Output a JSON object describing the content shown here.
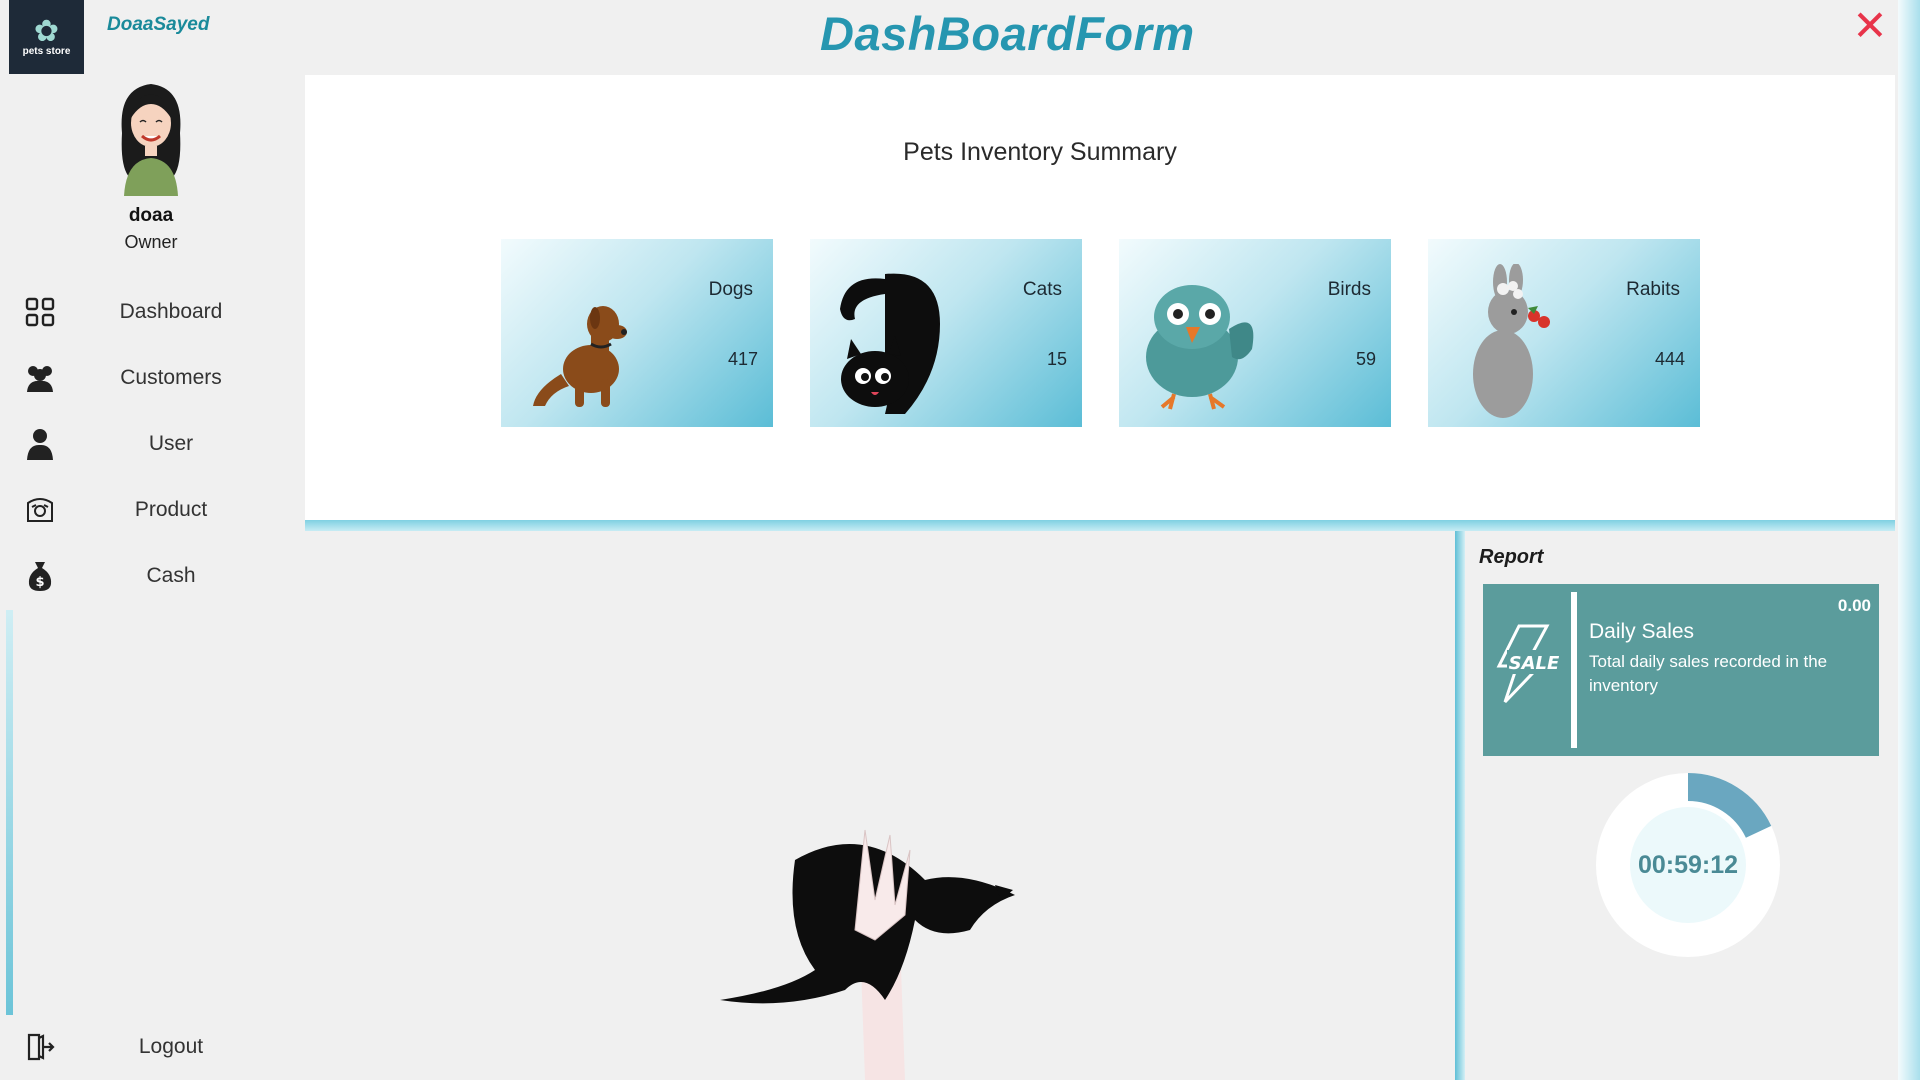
{
  "window": {
    "title": "DashBoardForm",
    "close_glyph": "✕"
  },
  "sidebar": {
    "brand": "DoaaSayed",
    "logo_text": "pets store",
    "user": {
      "name": "doaa",
      "role": "Owner"
    },
    "items": [
      {
        "label": "Dashboard",
        "icon": "dashboard-grid-icon"
      },
      {
        "label": "Customers",
        "icon": "customers-icon"
      },
      {
        "label": "User",
        "icon": "user-icon"
      },
      {
        "label": "Product",
        "icon": "product-icon"
      },
      {
        "label": "Cash",
        "icon": "money-bag-icon"
      }
    ],
    "logout_label": "Logout"
  },
  "summary": {
    "title": "Pets Inventory Summary",
    "cards": [
      {
        "label": "Dogs",
        "count": "417",
        "icon": "dog-icon"
      },
      {
        "label": "Cats",
        "count": "15",
        "icon": "cat-icon"
      },
      {
        "label": "Birds",
        "count": "59",
        "icon": "bird-icon"
      },
      {
        "label": "Rabits",
        "count": "444",
        "icon": "rabbit-icon"
      }
    ]
  },
  "report": {
    "title": "Report",
    "daily_sales": {
      "value": "0.00",
      "title": "Daily Sales",
      "description": "Total daily sales recorded in the inventory",
      "icon_text": "SALE"
    },
    "timer": {
      "text": "00:59:12",
      "progress": 0.18
    }
  },
  "colors": {
    "accent": "#2696b0",
    "close": "#e8344a",
    "sale_card": "#5b9c9c",
    "timer_arc": "#6aa7c0"
  }
}
